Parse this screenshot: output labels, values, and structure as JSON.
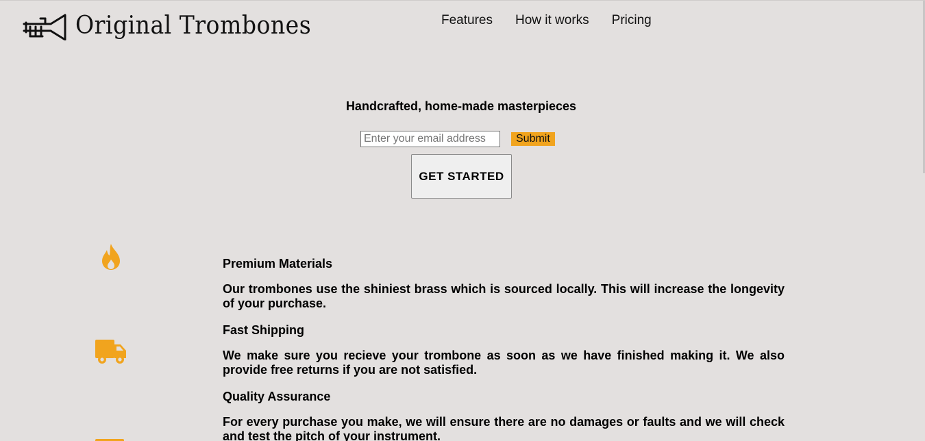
{
  "header": {
    "logo_text": "Original Trombones",
    "logo_icon": "trumpet-icon"
  },
  "nav": {
    "items": [
      {
        "label": "Features"
      },
      {
        "label": "How it works"
      },
      {
        "label": "Pricing"
      }
    ]
  },
  "hero": {
    "tagline": "Handcrafted, home-made masterpieces",
    "email_placeholder": "Enter your email address",
    "email_value": "",
    "submit_label": "Submit",
    "get_started_label": "GET STARTED"
  },
  "features": [
    {
      "icon": "fire-icon",
      "title": "Premium Materials",
      "description": "Our trombones use the shiniest brass which is sourced locally. This will increase the longevity of your purchase."
    },
    {
      "icon": "truck-icon",
      "title": "Fast Shipping",
      "description": "We make sure you recieve your trombone as soon as we have finished making it. We also provide free returns if you are not satisfied."
    },
    {
      "icon": "battery-icon",
      "title": "Quality Assurance",
      "description": "For every purchase you make, we will ensure there are no damages or faults and we will check and test the pitch of your instrument."
    }
  ],
  "colors": {
    "background": "#e3e0df",
    "accent": "#f1a41e"
  }
}
